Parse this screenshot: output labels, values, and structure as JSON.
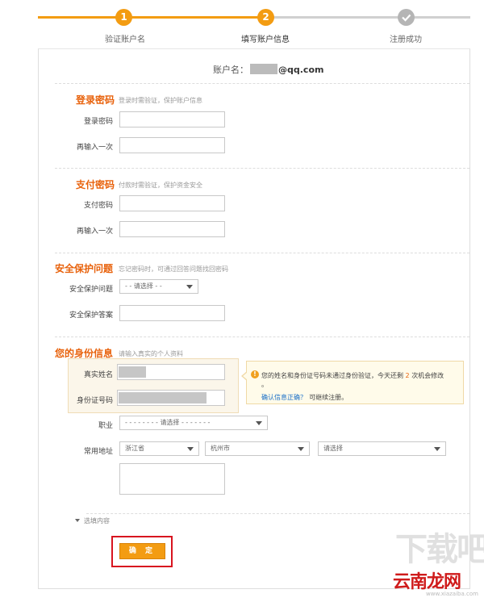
{
  "steps": [
    {
      "number": "1",
      "label": "验证账户名"
    },
    {
      "number": "2",
      "label": "填写账户信息"
    },
    {
      "label": "注册成功"
    }
  ],
  "account": {
    "label": "账户名：",
    "email_suffix": "@qq.com"
  },
  "login_password": {
    "title": "登录密码",
    "hint": "登录时需验证，保护账户信息",
    "password_label": "登录密码",
    "confirm_label": "再输入一次"
  },
  "payment_password": {
    "title": "支付密码",
    "hint": "付款时需验证，保护资金安全",
    "password_label": "支付密码",
    "confirm_label": "再输入一次"
  },
  "security_question": {
    "title": "安全保护问题",
    "hint": "忘记密码时，可通过回答问题找回密码",
    "question_label": "安全保护问题",
    "question_placeholder": "- - 请选择 - -",
    "answer_label": "安全保护答案"
  },
  "identity": {
    "title": "您的身份信息",
    "hint": "请输入真实的个人资料",
    "name_label": "真实姓名",
    "id_label": "身份证号码",
    "tip_text_1": "您的姓名和身份证号码未通过身份验证，今天还剩",
    "tip_count": "2",
    "tip_text_2": "次机会修改",
    "tip_text_3": "。",
    "tip_link": "确认信息正确？",
    "tip_text_4": "可继续注册。",
    "occupation_label": "职业",
    "occupation_placeholder": "- - - - - - - - 请选择 - - - - - - -",
    "address_label": "常用地址",
    "province": "浙江省",
    "city": "杭州市",
    "district": "请选择"
  },
  "optional_toggle": "选填内容",
  "confirm_button": "确 定",
  "watermark": {
    "big": "下载吧",
    "logo": "云南龙网",
    "url": "www.xiazaiba.com"
  },
  "colors": {
    "accent": "#f39c12",
    "title": "#e8620c",
    "link": "#1a6fc7",
    "highlight": "#d8141f"
  }
}
